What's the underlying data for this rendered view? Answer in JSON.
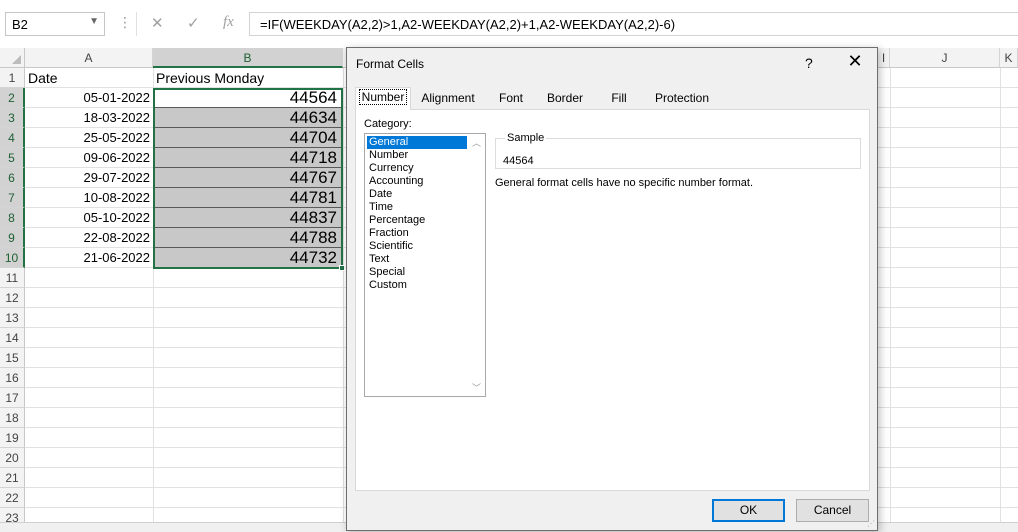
{
  "formula_bar": {
    "name_box": "B2",
    "name_box_arrow": "▼",
    "dots": "⋮",
    "cancel_glyph": "✕",
    "enter_glyph": "✓",
    "fx_glyph": "fx",
    "formula": "=IF(WEEKDAY(A2,2)>1,A2-WEEKDAY(A2,2)+1,A2-WEEKDAY(A2,2)-6)"
  },
  "columns": [
    "A",
    "B",
    "I",
    "J",
    "K"
  ],
  "rows": [
    "1",
    "2",
    "3",
    "4",
    "5",
    "6",
    "7",
    "8",
    "9",
    "10",
    "11",
    "12",
    "13",
    "14",
    "15",
    "16",
    "17",
    "18",
    "19",
    "20",
    "21",
    "22",
    "23"
  ],
  "headers": {
    "a1": "Date",
    "b1": "Previous Monday"
  },
  "data_rows": [
    {
      "date": "05-01-2022",
      "value": "44564"
    },
    {
      "date": "18-03-2022",
      "value": "44634"
    },
    {
      "date": "25-05-2022",
      "value": "44704"
    },
    {
      "date": "09-06-2022",
      "value": "44718"
    },
    {
      "date": "29-07-2022",
      "value": "44767"
    },
    {
      "date": "10-08-2022",
      "value": "44781"
    },
    {
      "date": "05-10-2022",
      "value": "44837"
    },
    {
      "date": "22-08-2022",
      "value": "44788"
    },
    {
      "date": "21-06-2022",
      "value": "44732"
    }
  ],
  "dialog": {
    "title": "Format Cells",
    "help": "?",
    "close": "✕",
    "tabs": [
      "Number",
      "Alignment",
      "Font",
      "Border",
      "Fill",
      "Protection"
    ],
    "active_tab": "Number",
    "category_label": "Category:",
    "categories": [
      "General",
      "Number",
      "Currency",
      "Accounting",
      "Date",
      "Time",
      "Percentage",
      "Fraction",
      "Scientific",
      "Text",
      "Special",
      "Custom"
    ],
    "selected_category": "General",
    "sample_label": "Sample",
    "sample_value": "44564",
    "description": "General format cells have no specific number format.",
    "ok": "OK",
    "cancel": "Cancel"
  },
  "colors": {
    "selection_green": "#217346",
    "selected_item_blue": "#0078d7",
    "cell_fill_gray": "#c8c8c8"
  }
}
